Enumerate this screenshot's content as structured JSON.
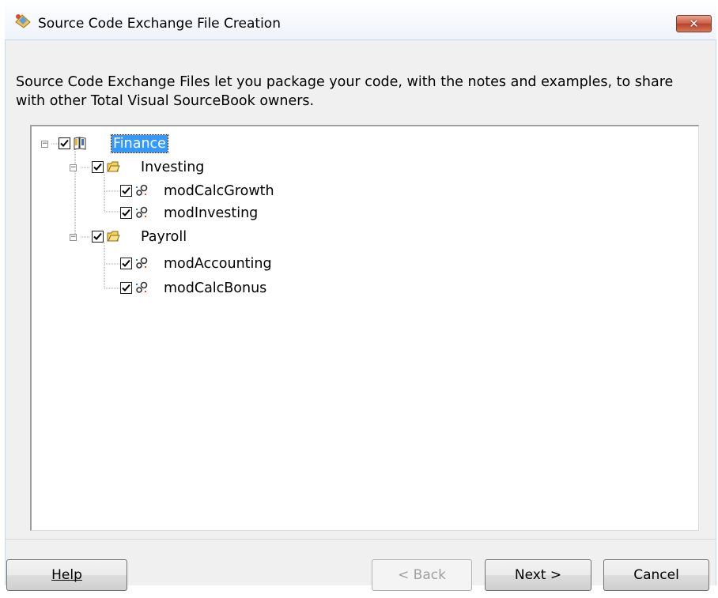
{
  "window": {
    "title": "Source Code Exchange File Creation",
    "close_glyph": "✕"
  },
  "description": "Source Code Exchange Files let you package your code, with the notes and examples, to share with other Total Visual SourceBook owners.",
  "tree": [
    {
      "label": "Finance",
      "icon": "book-icon",
      "checked": true,
      "selected": true,
      "expanded": true,
      "level": 0
    },
    {
      "label": "Investing",
      "icon": "folder-icon",
      "checked": true,
      "expanded": true,
      "level": 1
    },
    {
      "label": "modCalcGrowth",
      "icon": "module-icon",
      "checked": true,
      "level": 2
    },
    {
      "label": "modInvesting",
      "icon": "module-icon",
      "checked": true,
      "level": 2
    },
    {
      "label": "Payroll",
      "icon": "folder-icon",
      "checked": true,
      "expanded": true,
      "level": 1
    },
    {
      "label": "modAccounting",
      "icon": "module-icon",
      "checked": true,
      "level": 2
    },
    {
      "label": "modCalcBonus",
      "icon": "module-icon",
      "checked": true,
      "level": 2
    }
  ],
  "buttons": {
    "help": {
      "label": "Help",
      "accel": "H"
    },
    "back": {
      "label": "< Back",
      "accel": "B",
      "enabled": false
    },
    "next": {
      "label": "Next >",
      "accel": "N"
    },
    "cancel": {
      "label": "Cancel",
      "accel": "C"
    }
  },
  "colors": {
    "selection": "#3399ff",
    "dialog_bg": "#f0f0f0",
    "close_button": "#c85a3f"
  }
}
